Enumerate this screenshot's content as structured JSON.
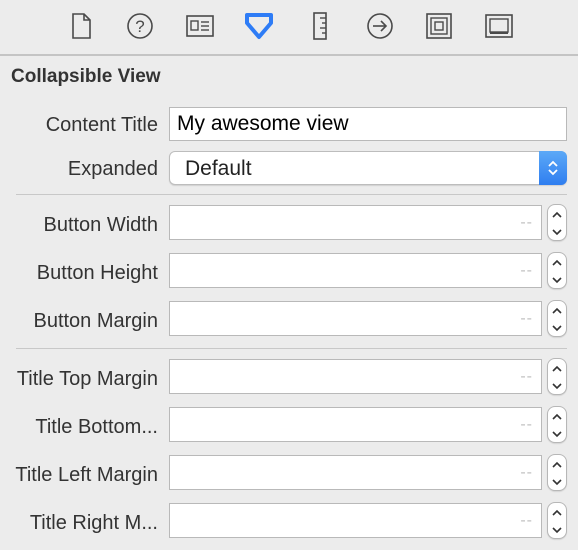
{
  "toolbar": {
    "icons": [
      "file-icon",
      "help-icon",
      "identity-icon",
      "attributes-icon",
      "size-ruler-icon",
      "connections-arrow-icon",
      "bindings-icon",
      "view-effects-icon"
    ],
    "active_icon": "attributes-icon",
    "active_color": "#2e7cf6",
    "icon_color": "#4a4a4a"
  },
  "section": {
    "title": "Collapsible View"
  },
  "content_title": {
    "label": "Content Title",
    "value": "My awesome view"
  },
  "expanded": {
    "label": "Expanded",
    "value": "Default"
  },
  "button_fields": [
    {
      "label": "Button Width",
      "placeholder": "--"
    },
    {
      "label": "Button Height",
      "placeholder": "--"
    },
    {
      "label": "Button Margin",
      "placeholder": "--"
    }
  ],
  "title_fields": [
    {
      "label": "Title Top Margin",
      "placeholder": "--"
    },
    {
      "label": "Title Bottom...",
      "placeholder": "--"
    },
    {
      "label": "Title Left Margin",
      "placeholder": "--"
    },
    {
      "label": "Title Right M...",
      "placeholder": "--"
    }
  ]
}
